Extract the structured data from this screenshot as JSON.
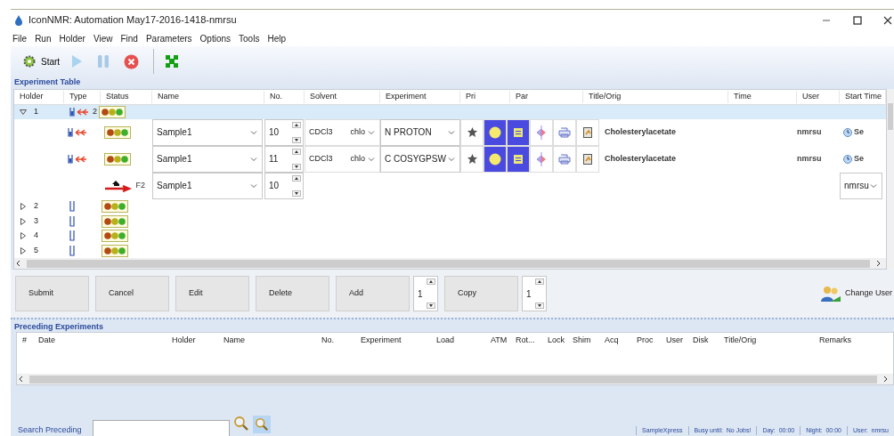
{
  "window": {
    "title": "IconNMR: Automation May17-2016-1418-nmrsu"
  },
  "menu": [
    "File",
    "Run",
    "Holder",
    "View",
    "Find",
    "Parameters",
    "Options",
    "Tools",
    "Help"
  ],
  "toolbar": [
    {
      "kind": "start",
      "label": "Start",
      "disabled": false
    },
    {
      "kind": "play",
      "disabled": true
    },
    {
      "kind": "pause",
      "disabled": true
    },
    {
      "kind": "stop",
      "disabled": false
    },
    {
      "kind": "grid",
      "disabled": false
    }
  ],
  "experiment_table": {
    "title": "Experiment Table",
    "columns": [
      "Holder",
      "Type",
      "Status",
      "Name",
      "No.",
      "Solvent",
      "Experiment",
      "Pri",
      "Par",
      "Title/Orig",
      "Time",
      "User",
      "Start Time"
    ],
    "holders": [
      {
        "label": "1",
        "expanded": true,
        "selected": true,
        "count": "2",
        "children": [
          {
            "kind": "experiment",
            "name": "Sample1",
            "no": "10",
            "solvent": "CDCl3",
            "solvent_short": "chlo",
            "experiment": "N PROTON",
            "title": "Cholesterylacetate",
            "user": "nmrsu",
            "start_time": "Se"
          },
          {
            "kind": "experiment",
            "name": "Sample1",
            "no": "11",
            "solvent": "CDCl3",
            "solvent_short": "chlo",
            "experiment": "C COSYGPSW",
            "title": "Cholesterylacetate",
            "user": "nmrsu",
            "start_time": "Se"
          },
          {
            "kind": "new",
            "label": "F2",
            "name": "Sample1",
            "no": "10",
            "user": "nmrsu"
          }
        ]
      },
      {
        "label": "2",
        "expanded": false,
        "selected": false
      },
      {
        "label": "3",
        "expanded": false,
        "selected": false
      },
      {
        "label": "4",
        "expanded": false,
        "selected": false
      },
      {
        "label": "5",
        "expanded": false,
        "selected": false
      }
    ]
  },
  "actions": [
    {
      "label": "Submit"
    },
    {
      "label": "Cancel"
    },
    {
      "label": "Edit"
    },
    {
      "label": "Delete"
    },
    {
      "label": "Add",
      "count": "1"
    },
    {
      "label": "Copy",
      "count": "1"
    }
  ],
  "change_user": {
    "label": "Change User"
  },
  "preceding": {
    "title": "Preceding Experiments",
    "columns": [
      "#",
      "Date",
      "Holder",
      "Name",
      "No.",
      "Experiment",
      "Load",
      "ATM",
      "Rot...",
      "Lock",
      "Shim",
      "Acq",
      "Proc",
      "User",
      "Disk",
      "Title/Orig",
      "Remarks"
    ]
  },
  "search": {
    "label": "Search Preceding"
  },
  "status_bar": [
    "SampleXpress",
    "Busy until:  No Jobs!",
    "Day:  00:00",
    "Night:  00:00",
    "User:  nmrsu"
  ]
}
